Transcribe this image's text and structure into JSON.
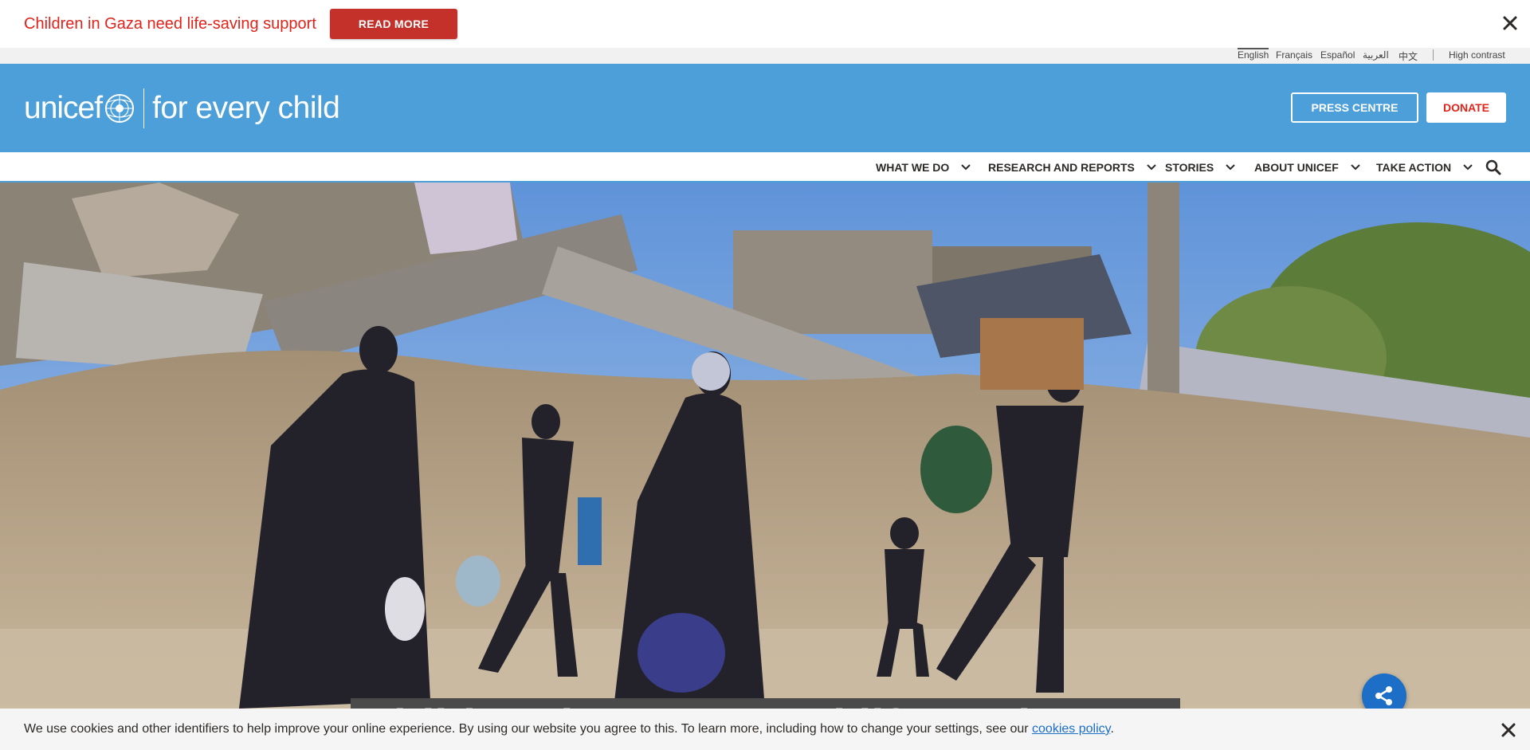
{
  "alert": {
    "text": "Children in Gaza need life-saving support",
    "button_label": "READ MORE"
  },
  "languages": [
    "English",
    "Français",
    "Español",
    "العربية",
    "中文"
  ],
  "high_contrast_label": "High contrast",
  "header": {
    "logo_word": "unicef",
    "tagline": "for every child",
    "press_label": "PRESS CENTRE",
    "donate_label": "DONATE"
  },
  "nav": {
    "items": [
      "WHAT WE DO",
      "RESEARCH AND REPORTS",
      "STORIES",
      "ABOUT UNICEF",
      "TAKE ACTION"
    ]
  },
  "hero": {
    "title": "Children in Gaza need life-saving support"
  },
  "cookie": {
    "text": "We use cookies and other identifiers to help improve your online experience. By using our website you agree to this. To learn more, including how to change your settings, see our ",
    "link": "cookies policy",
    "end": "."
  },
  "colors": {
    "brand_blue": "#4c9fd8",
    "alert_red": "#e2231a",
    "button_red": "#c4312b",
    "share_blue": "#1c6ec7"
  },
  "icons": [
    "close-icon",
    "un-globe-icon",
    "chevron-down-icon",
    "search-icon",
    "share-icon"
  ]
}
